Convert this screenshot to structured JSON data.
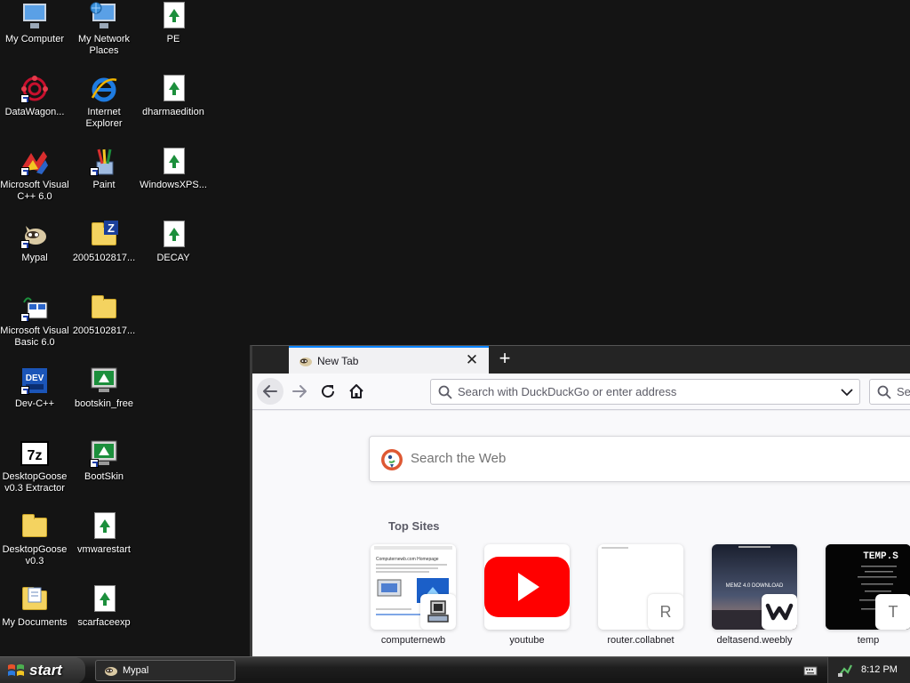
{
  "desktop": {
    "icons": [
      {
        "label": "My Computer",
        "icon": "my-computer-icon"
      },
      {
        "label": "My Network Places",
        "icon": "network-places-icon"
      },
      {
        "label": "PE",
        "icon": "document-icon"
      },
      {
        "label": "DataWagon...",
        "icon": "datawagon-icon"
      },
      {
        "label": "Internet Explorer",
        "icon": "internet-explorer-icon"
      },
      {
        "label": "dharmaedition",
        "icon": "document-icon"
      },
      {
        "label": "Microsoft Visual C++ 6.0",
        "icon": "visual-cpp-icon"
      },
      {
        "label": "Paint",
        "icon": "paint-icon"
      },
      {
        "label": "WindowsXPS...",
        "icon": "document-icon"
      },
      {
        "label": "Mypal",
        "icon": "mypal-icon"
      },
      {
        "label": "2005102817...",
        "icon": "zip-folder-icon"
      },
      {
        "label": "DECAY",
        "icon": "document-icon"
      },
      {
        "label": "Microsoft Visual Basic 6.0",
        "icon": "visual-basic-icon"
      },
      {
        "label": "2005102817...",
        "icon": "folder-icon"
      },
      {
        "label": "Dev-C++",
        "icon": "devcpp-icon"
      },
      {
        "label": "bootskin_free",
        "icon": "bootskin-icon"
      },
      {
        "label": "DesktopGoose v0.3 Extractor",
        "icon": "7zip-icon"
      },
      {
        "label": "BootSkin",
        "icon": "bootskin-icon"
      },
      {
        "label": "DesktopGoose v0.3",
        "icon": "folder-icon"
      },
      {
        "label": "vmwarestart",
        "icon": "document-icon"
      },
      {
        "label": "My Documents",
        "icon": "my-documents-icon"
      },
      {
        "label": "scarfaceexp",
        "icon": "document-icon"
      }
    ]
  },
  "browser": {
    "tab": {
      "title": "New Tab",
      "close": "✕",
      "new_tab": "+"
    },
    "nav": {
      "back": "back-arrow-icon",
      "forward": "forward-arrow-icon",
      "reload": "reload-icon",
      "home": "home-icon"
    },
    "url_bar": {
      "placeholder": "Search with DuckDuckGo or enter address"
    },
    "search_bar": {
      "placeholder": "Se"
    },
    "newtab_page": {
      "search_placeholder": "Search the Web",
      "top_sites_title": "Top Sites",
      "tiles": [
        {
          "label": "computernewb",
          "badge": ""
        },
        {
          "label": "youtube",
          "badge": ""
        },
        {
          "label": "router.collabnet",
          "badge": "R"
        },
        {
          "label": "deltasend.weebly",
          "badge": "w"
        },
        {
          "label": "temp",
          "badge": "T"
        }
      ],
      "thumb_texts": {
        "computernewb": "Computernewb.com Homepage",
        "deltasend": "MEMZ 4.0 DOWNLOAD",
        "temp": "TEMP.S"
      }
    }
  },
  "taskbar": {
    "start_label": "start",
    "tasks": [
      {
        "label": "Mypal",
        "icon": "mypal-icon"
      }
    ],
    "clock": "8:12 PM"
  },
  "colors": {
    "desktop_bg": "#141414",
    "tab_accent": "#0a84ff",
    "youtube_red": "#ff0000",
    "ddg_orange": "#de5833"
  }
}
